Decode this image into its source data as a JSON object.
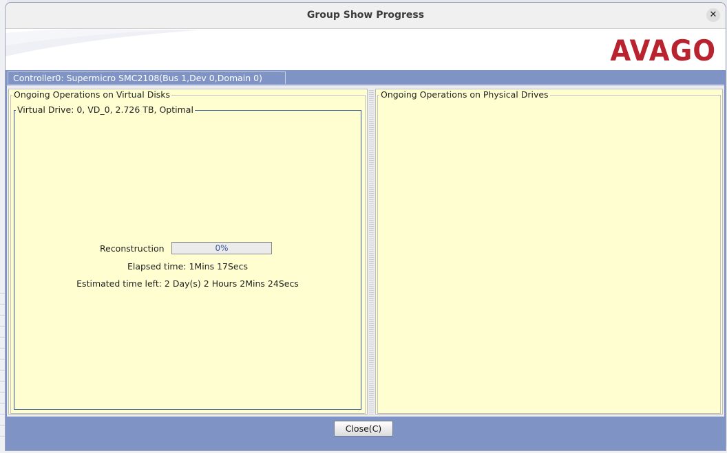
{
  "window": {
    "title": "Group Show Progress"
  },
  "brand": {
    "logo_text": "AVAGO",
    "logo_color": "#b8232f"
  },
  "tab": {
    "label": "Controller0: Supermicro SMC2108(Bus 1,Dev 0,Domain 0)"
  },
  "virtual_disks": {
    "title": "Ongoing Operations on Virtual Disks",
    "drive": {
      "title": "Virtual Drive: 0, VD_0, 2.726 TB, Optimal",
      "operation_label": "Reconstruction",
      "progress_percent": 0,
      "progress_text": "0%",
      "elapsed": "Elapsed time: 1Mins 17Secs",
      "estimated": "Estimated time left: 2 Day(s) 2 Hours 2Mins 24Secs"
    }
  },
  "physical_drives": {
    "title": "Ongoing Operations on Physical Drives"
  },
  "footer": {
    "close_label": "Close(C)"
  },
  "colors": {
    "frame": "#7f94c4",
    "panel_bg": "#fefed0",
    "accent_blue": "#2a4f8c"
  }
}
